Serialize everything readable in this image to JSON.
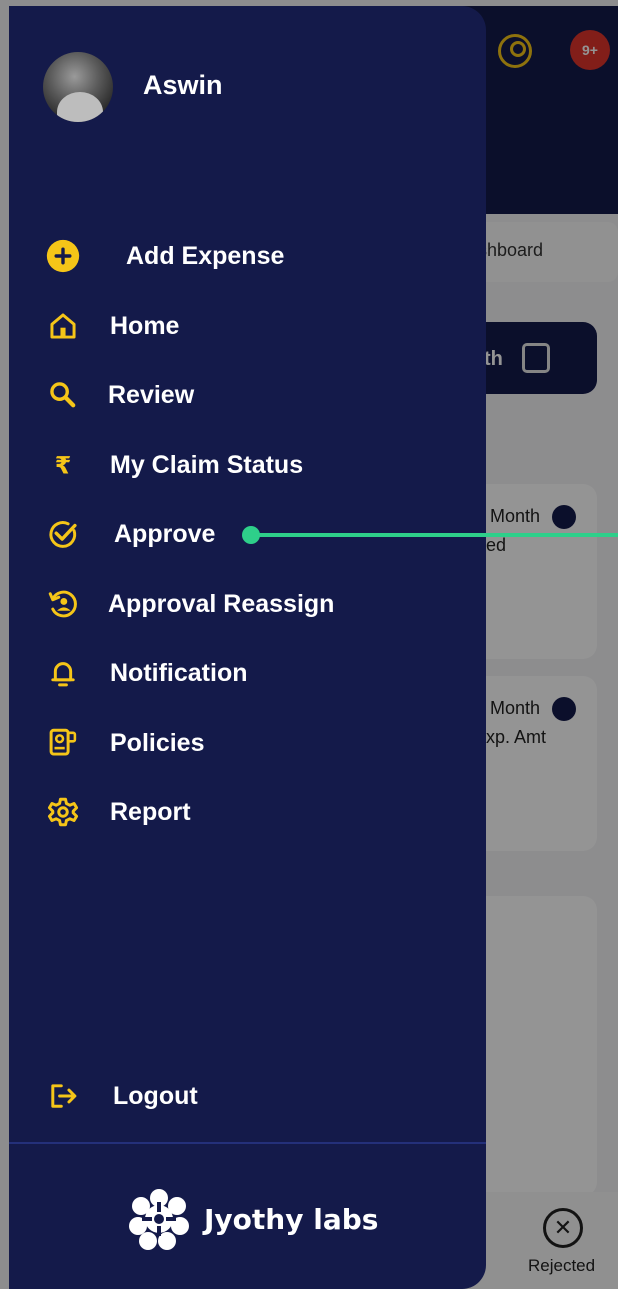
{
  "background_app": {
    "notification_badge": "9+",
    "tab_label": "shboard",
    "month_button_text": "th",
    "card1": {
      "title": "Month",
      "subtitle": "ed"
    },
    "card2": {
      "title": "Month",
      "subtitle": "xp. Amt"
    },
    "rejected_label": "Rejected"
  },
  "drawer": {
    "user": {
      "name": "Aswin"
    },
    "menu": [
      {
        "key": "add_expense",
        "label": "Add Expense",
        "icon": "plus-circle-icon"
      },
      {
        "key": "home",
        "label": "Home",
        "icon": "home-icon"
      },
      {
        "key": "review",
        "label": "Review",
        "icon": "search-icon"
      },
      {
        "key": "claim_status",
        "label": "My Claim Status",
        "icon": "rupee-icon"
      },
      {
        "key": "approve",
        "label": "Approve",
        "icon": "check-badge-icon"
      },
      {
        "key": "approval_reassign",
        "label": "Approval Reassign",
        "icon": "reassign-icon"
      },
      {
        "key": "notification",
        "label": "Notification",
        "icon": "bell-icon"
      },
      {
        "key": "policies",
        "label": "Policies",
        "icon": "policy-icon"
      },
      {
        "key": "report",
        "label": "Report",
        "icon": "gear-icon"
      }
    ],
    "logout_label": "Logout",
    "brand_name": "Jyothy labs"
  },
  "colors": {
    "drawer_bg": "#141a4a",
    "accent_yellow": "#f5c518",
    "pointer_green": "#2ecf8a"
  }
}
